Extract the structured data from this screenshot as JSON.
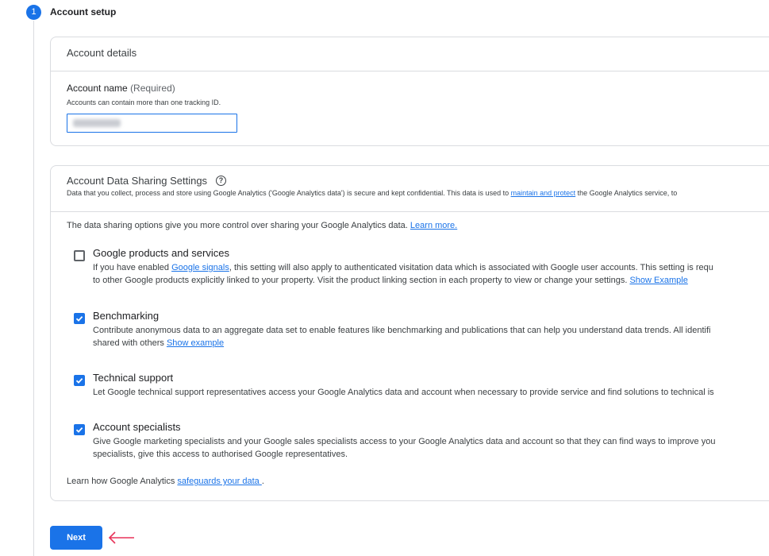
{
  "step": {
    "number": "1",
    "title": "Account setup"
  },
  "account_details": {
    "header": "Account details",
    "field_label": "Account name",
    "required_label": "(Required)",
    "hint": "Accounts can contain more than one tracking ID.",
    "input_value": ""
  },
  "sharing": {
    "title": "Account Data Sharing Settings",
    "help_icon": "help-circle-icon",
    "desc_text": "Data that you collect, process and store using Google Analytics ('Google Analytics data') is secure and kept confidential. This data is used to ",
    "desc_link": "maintain and protect",
    "desc_tail": " the Google Analytics service, to",
    "intro_text": "The data sharing options give you more control over sharing your Google Analytics data. ",
    "intro_link": "Learn more.",
    "options": [
      {
        "title": "Google products and services",
        "checked": false,
        "line1_pre": "If you have enabled ",
        "line1_link": "Google signals",
        "line1_post": ", this setting will also apply to authenticated visitation data which is associated with Google user accounts. This setting is requ",
        "line2_pre": "to other Google products explicitly linked to your property. Visit the product linking section in each property to view or change your settings. ",
        "line2_link": "Show Example"
      },
      {
        "title": "Benchmarking",
        "checked": true,
        "line1": "Contribute anonymous data to an aggregate data set to enable features like benchmarking and publications that can help you understand data trends. All identifi",
        "line2_pre": "shared with others ",
        "line2_link": "Show example"
      },
      {
        "title": "Technical support",
        "checked": true,
        "line1": "Let Google technical support representatives access your Google Analytics data and account when necessary to provide service and find solutions to technical is"
      },
      {
        "title": "Account specialists",
        "checked": true,
        "line1": "Give Google marketing specialists and your Google sales specialists access to your Google Analytics data and account so that they can find ways to improve you",
        "line2": "specialists, give this access to authorised Google representatives."
      }
    ],
    "learn_pre": "Learn how Google Analytics ",
    "learn_link": "safeguards your data ",
    "learn_post": "."
  },
  "next_button": "Next",
  "colors": {
    "accent": "#1a73e8",
    "arrow": "#e8335a"
  }
}
